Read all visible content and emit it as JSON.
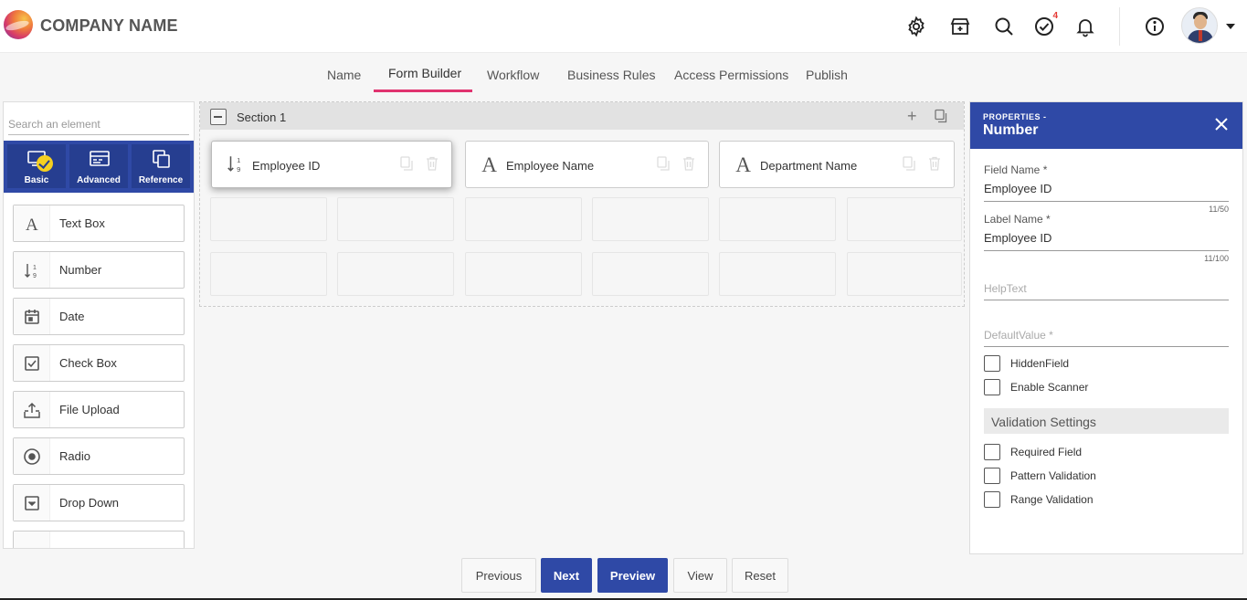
{
  "header": {
    "company_name": "COMPANY NAME",
    "tasks_badge": "4",
    "icons": [
      "settings-icon",
      "store-icon",
      "search-icon",
      "tasks-icon",
      "bell-icon",
      "info-icon"
    ]
  },
  "tabs": [
    {
      "label": "Name"
    },
    {
      "label": "Form Builder",
      "active": true
    },
    {
      "label": "Workflow"
    },
    {
      "label": "Business Rules"
    },
    {
      "label": "Access Permissions"
    },
    {
      "label": "Publish"
    }
  ],
  "palette": {
    "search_placeholder": "Search an element",
    "categories": [
      {
        "label": "Basic",
        "selected": true
      },
      {
        "label": "Advanced"
      },
      {
        "label": "Reference"
      }
    ],
    "elements": [
      {
        "label": "Text Box",
        "icon": "text-icon"
      },
      {
        "label": "Number",
        "icon": "number-icon"
      },
      {
        "label": "Date",
        "icon": "calendar-icon"
      },
      {
        "label": "Check Box",
        "icon": "checkbox-icon"
      },
      {
        "label": "File Upload",
        "icon": "upload-icon"
      },
      {
        "label": "Radio",
        "icon": "radio-icon"
      },
      {
        "label": "Drop Down",
        "icon": "dropdown-icon"
      }
    ]
  },
  "canvas": {
    "section_title": "Section 1",
    "fields": [
      {
        "label": "Employee ID",
        "icon": "number-icon",
        "selected": true
      },
      {
        "label": "Employee Name",
        "icon": "text-icon"
      },
      {
        "label": "Department Name",
        "icon": "text-icon"
      }
    ]
  },
  "properties": {
    "subtitle": "PROPERTIES -",
    "title": "Number",
    "field_name_label": "Field Name *",
    "field_name_value": "Employee ID",
    "field_name_count": "11/50",
    "label_name_label": "Label Name *",
    "label_name_value": "Employee ID",
    "label_name_count": "11/100",
    "help_text_placeholder": "HelpText",
    "default_value_placeholder": "DefaultValue *",
    "hidden_field": "HiddenField",
    "enable_scanner": "Enable Scanner",
    "validation_title": "Validation Settings",
    "required_field": "Required Field",
    "pattern_validation": "Pattern Validation",
    "range_validation": "Range Validation"
  },
  "actions": {
    "previous": "Previous",
    "next": "Next",
    "preview": "Preview",
    "view": "View",
    "reset": "Reset"
  },
  "colors": {
    "primary": "#2f49a6",
    "accent": "#e0336f",
    "badge": "#e53935",
    "check": "#f5d020"
  }
}
